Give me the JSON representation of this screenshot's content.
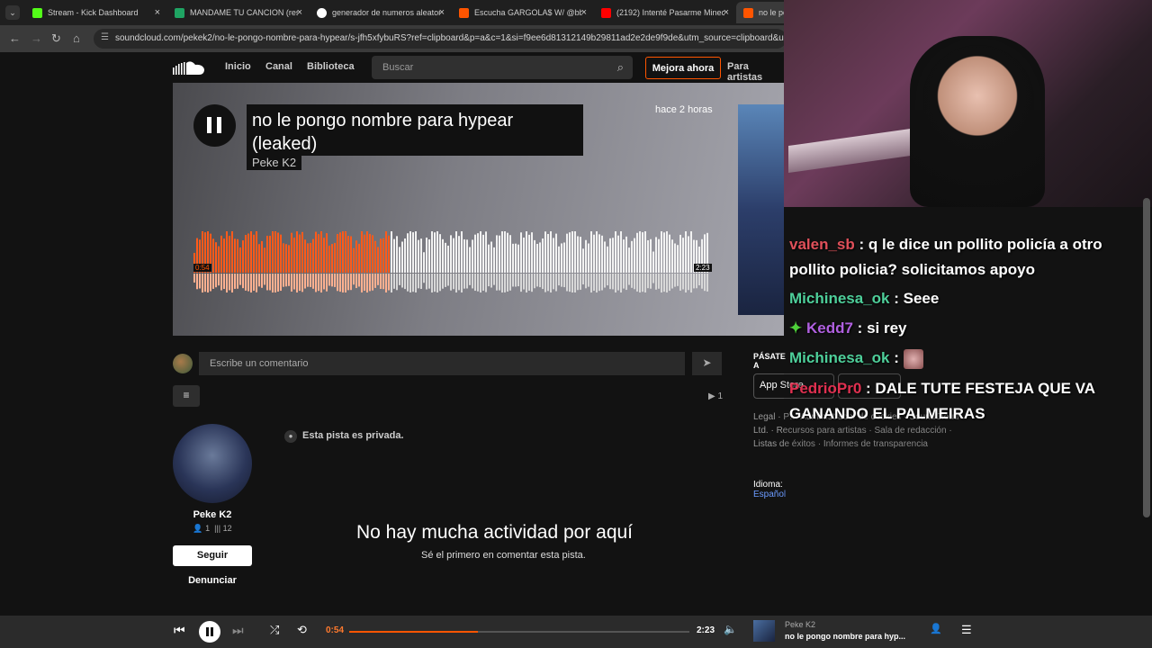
{
  "browser": {
    "tabs": [
      {
        "label": "Stream - Kick Dashboard",
        "icon": "kick-icon",
        "color": "#53fc18"
      },
      {
        "label": "MANDAME TU CANCION (resp",
        "icon": "sheets-icon",
        "color": "#1fa463"
      },
      {
        "label": "generador de numeros aleator",
        "icon": "google-icon",
        "color": "#ffffff"
      },
      {
        "label": "Escucha GARGOLA$ W/ @bby.",
        "icon": "soundcloud-icon",
        "color": "#ff5500"
      },
      {
        "label": "(2192) Intenté Pasarme Minecr",
        "icon": "youtube-icon",
        "color": "#ff0000"
      },
      {
        "label": "no le po",
        "icon": "soundcloud-icon",
        "color": "#ff5500"
      }
    ],
    "url": "soundcloud.com/pekek2/no-le-pongo-nombre-para-hypear/s-jfh5xfybuRS?ref=clipboard&p=a&c=1&si=f9ee6d81312149b29811ad2e2de9f9de&utm_source=clipboard&utm_med"
  },
  "header": {
    "nav": [
      "Inicio",
      "Canal",
      "Biblioteca"
    ],
    "search_placeholder": "Buscar",
    "upgrade_label": "Mejora ahora",
    "artists_label": "Para artistas"
  },
  "hero": {
    "title": "no le pongo nombre para hypear (leaked)",
    "artist": "Peke K2",
    "date": "hace 2 horas",
    "elapsed": "0:54",
    "duration": "2:23",
    "progress": 0.378
  },
  "comments": {
    "placeholder": "Escribe un comentario",
    "plays": "1",
    "private_text": "Esta pista es privada.",
    "empty_title": "No hay mucha actividad por aquí",
    "empty_sub": "Sé el primero en comentar esta pista."
  },
  "uploader": {
    "name": "Peke K2",
    "followers": "1",
    "tracks": "12",
    "follow_label": "Seguir",
    "report_label": "Denunciar"
  },
  "sidebar": {
    "title": "PÁSATE A",
    "app_store": "App Store",
    "footer": "Legal · P… Administrador de cookies · SoundCloud Ltd. · Recursos para artistas · Sala de redacción · Listas de éxitos · Informes de transparencia",
    "lang_label": "Idioma:",
    "lang_value": "Español"
  },
  "player": {
    "elapsed": "0:54",
    "duration": "2:23",
    "progress": 0.378,
    "artist": "Peke K2",
    "title": "no le pongo nombre para hyp..."
  },
  "chat": [
    {
      "user": "valen_sb",
      "color": "#e0505a",
      "text": "q le dice un pollito policía a otro pollito policia? solicitamos apoyo"
    },
    {
      "user": "Michinesa_ok",
      "color": "#4ecf9a",
      "text": "Seee"
    },
    {
      "user": "Kedd7",
      "color": "#b060e0",
      "text": "si rey"
    },
    {
      "user": "Michinesa_ok",
      "color": "#4ecf9a",
      "text": ""
    },
    {
      "user": "PedrioPr0",
      "color": "#e03050",
      "text": "DALE TUTE FESTEJA QUE VA GANANDO EL PALMEIRAS"
    }
  ]
}
